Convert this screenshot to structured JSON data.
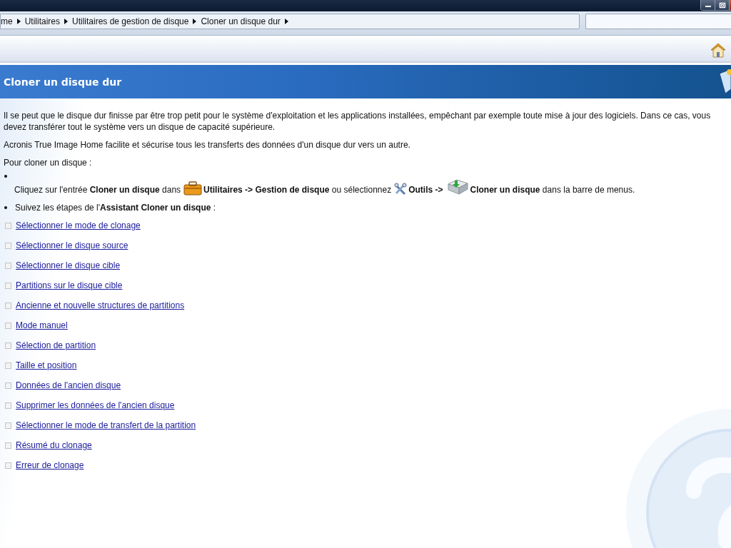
{
  "window": {
    "controls": [
      {
        "kind": "minimize"
      },
      {
        "kind": "restore"
      }
    ]
  },
  "address_bar": {
    "breadcrumbs": [
      "me",
      "Utilitaires",
      "Utilitaires de gestion de disque",
      "Cloner un disque dur"
    ]
  },
  "header": {
    "title": "Cloner un disque dur"
  },
  "paragraphs": [
    "Il se peut que le disque dur finisse par être trop petit pour le système d'exploitation et les applications installées, empêchant par exemple toute mise à jour des logiciels. Dans ce cas, vous devez transférer tout le système vers un disque de capacité supérieure.",
    "Acronis True Image Home facilite et sécurise tous les transferts des données d'un disque dur vers un autre.",
    "Pour cloner un disque :"
  ],
  "bullets": [
    {
      "parts": [
        {
          "kind": "text",
          "text": "Cliquez sur l'entrée **Cloner un disque** dans"
        },
        {
          "kind": "icon"
        },
        {
          "kind": "text",
          "text": "**Utilitaires -> Gestion de disque** ou sélectionnez"
        },
        {
          "kind": "icon"
        },
        {
          "kind": "text",
          "text": "**Outils ->**"
        },
        {
          "kind": "icon"
        },
        {
          "kind": "text",
          "text": "**Cloner un disque** dans la barre de menus."
        }
      ]
    },
    {
      "parts": [
        {
          "kind": "text",
          "text": "Suivez les étapes de l'**Assistant Cloner un disque** :"
        }
      ]
    }
  ],
  "links": [
    "Sélectionner le mode de clonage",
    "Sélectionner le disque source",
    "Sélectionner le disque cible",
    "Partitions sur le disque cible",
    "Ancienne et nouvelle structures de partitions",
    "Mode manuel",
    "Sélection de partition",
    "Taille et position",
    "Données de l'ancien disque",
    "Supprimer les données de l'ancien disque",
    "Sélectionner le mode de transfert de la partition",
    "Résumé du clonage",
    "Erreur de clonage"
  ]
}
